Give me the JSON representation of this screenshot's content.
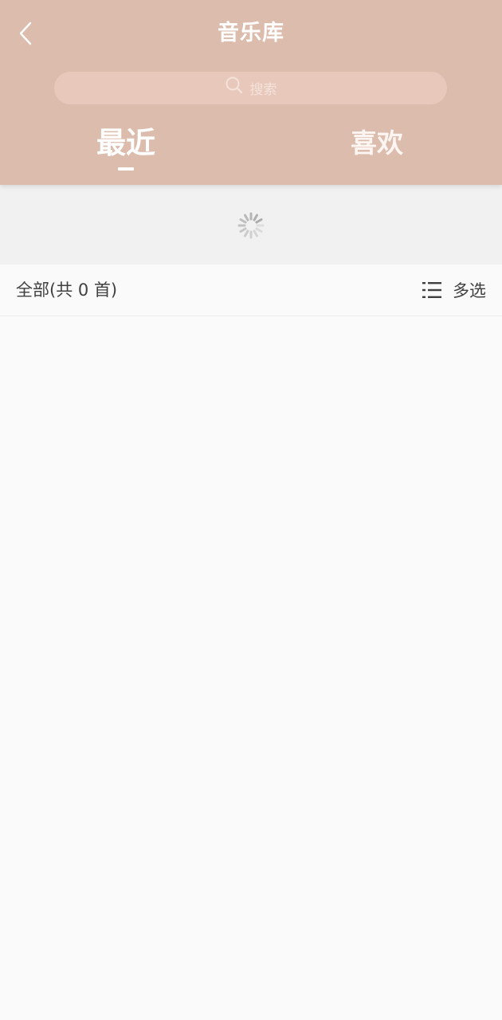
{
  "header": {
    "title": "音乐库",
    "back_icon": "chevron-left-icon",
    "background_color": "#dbbcad"
  },
  "search": {
    "placeholder": "搜索",
    "icon": "search-icon"
  },
  "tabs": [
    {
      "label": "最近",
      "active": true
    },
    {
      "label": "喜欢",
      "active": false
    }
  ],
  "loading": {
    "icon": "loading-spinner-icon"
  },
  "list": {
    "count_label": "全部(共 0 首)",
    "multi_select_label": "多选",
    "multi_select_icon": "list-icon"
  }
}
